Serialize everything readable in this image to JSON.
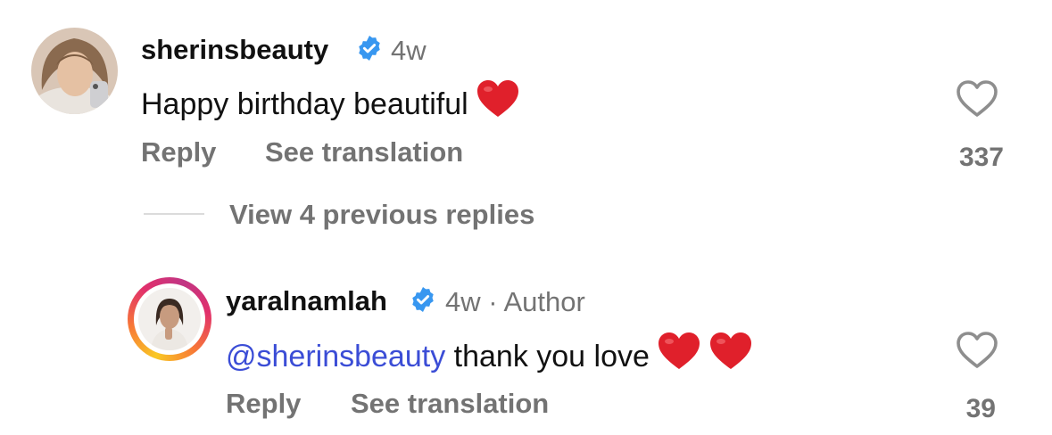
{
  "comment": {
    "username": "sherinsbeauty",
    "time": "4w",
    "text": "Happy birthday beautiful",
    "reply_label": "Reply",
    "translate_label": "See translation",
    "likes": "337"
  },
  "view_replies": {
    "label": "View 4 previous replies"
  },
  "reply": {
    "username": "yaralnamlah",
    "time": "4w",
    "separator": "·",
    "author_badge": "Author",
    "mention": "@sherinsbeauty",
    "text": "thank you love",
    "reply_label": "Reply",
    "translate_label": "See translation",
    "likes": "39"
  },
  "colors": {
    "verified": "#3897f0",
    "mention": "#3b4dd6",
    "muted": "#737373",
    "heart_emoji": "#e0202b"
  },
  "icons": {
    "verified": "verified-badge-icon",
    "like": "heart-outline-icon",
    "emoji": "red-heart-emoji"
  }
}
